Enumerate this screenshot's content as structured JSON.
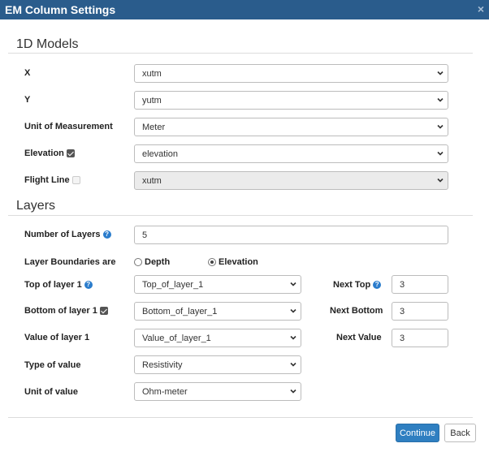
{
  "window": {
    "title": "EM Column Settings",
    "close_glyph": "×"
  },
  "models": {
    "section_title": "1D Models",
    "x": {
      "label": "X",
      "value": "xutm"
    },
    "y": {
      "label": "Y",
      "value": "yutm"
    },
    "unit": {
      "label": "Unit of Measurement",
      "value": "Meter"
    },
    "elevation": {
      "label": "Elevation",
      "checked": true,
      "value": "elevation"
    },
    "flight_line": {
      "label": "Flight Line",
      "checked": false,
      "value": "xutm"
    }
  },
  "layers": {
    "section_title": "Layers",
    "number": {
      "label": "Number of Layers",
      "value": "5"
    },
    "boundaries": {
      "label": "Layer Boundaries are",
      "option_depth": "Depth",
      "option_elevation": "Elevation",
      "selected": "Elevation"
    },
    "top": {
      "label": "Top of layer 1",
      "value": "Top_of_layer_1",
      "next_label": "Next Top",
      "next_value": "3"
    },
    "bottom": {
      "label": "Bottom of layer 1",
      "value": "Bottom_of_layer_1",
      "next_label": "Next Bottom",
      "next_value": "3"
    },
    "value": {
      "label": "Value of layer 1",
      "value": "Value_of_layer_1",
      "next_label": "Next Value",
      "next_value": "3"
    },
    "type": {
      "label": "Type of value",
      "value": "Resistivity"
    },
    "unit_value": {
      "label": "Unit of value",
      "value": "Ohm-meter"
    }
  },
  "footer": {
    "continue_label": "Continue",
    "back_label": "Back"
  },
  "colors": {
    "titlebar": "#2a5c8c",
    "primary": "#2f7fc1",
    "help_icon": "#2a7ccc"
  }
}
